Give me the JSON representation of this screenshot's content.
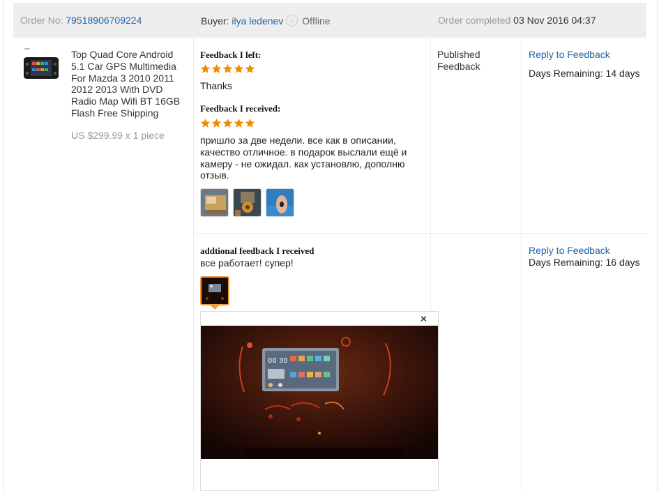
{
  "order": {
    "number_label": "Order No:",
    "number": "79518906709224",
    "buyer_label": "Buyer:",
    "buyer_name": "ilya ledenev",
    "buyer_status": "Offline",
    "completed_label": "Order completed",
    "completed_date": "03 Nov 2016 04:37"
  },
  "product": {
    "title": "Top Quad Core Android 5.1 Car GPS Multimedia For Mazda 3 2010 2011 2012 2013 With DVD Radio Map Wifi BT 16GB Flash Free Shipping",
    "price": "US $299.99 x 1 piece"
  },
  "feedback": {
    "left_heading": "Feedback I left:",
    "left_stars": 5,
    "left_text": "Thanks",
    "received_heading": "Feedback I received:",
    "received_stars": 5,
    "received_text": "пришло за две недели. все как в описании, качество отличное. в подарок выслали ещё и камеру - не ожидал. как установлю, дополню отзыв.",
    "additional_heading": "addtional feedback I received",
    "additional_text": "все работает! супер!"
  },
  "status": {
    "line1": "Published",
    "line2": "Feedback"
  },
  "actions": {
    "reply_label_1": "Reply to Feedback",
    "days_1": "Days Remaining: 14 days",
    "reply_label_2": "Reply to Feedback",
    "days_2": "Days Remaining: 16 days"
  },
  "viewer": {
    "close_glyph": "×"
  },
  "colors": {
    "link": "#2262a8",
    "star": "#f08c00",
    "header_bg": "#eeeeee",
    "selected_border": "#f1a040"
  },
  "icons": {
    "status": "clock-icon",
    "rating": "star-icon",
    "close": "close-icon"
  }
}
